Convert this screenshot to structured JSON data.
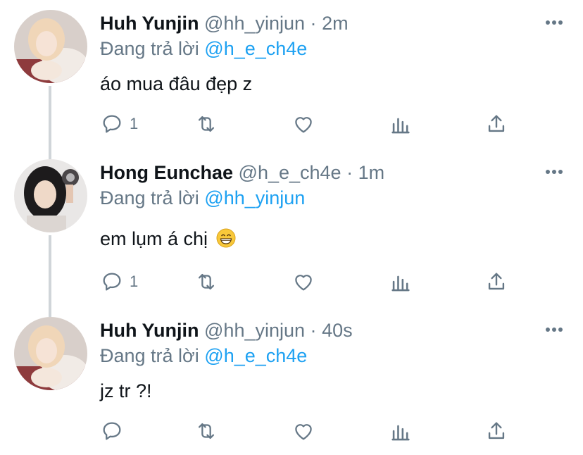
{
  "tweets": [
    {
      "name": "Huh Yunjin",
      "handle": "@hh_yinjun",
      "dot": "·",
      "time": "2m",
      "reply_prefix": "Đang trả lời",
      "reply_to": "@h_e_ch4e",
      "text": "áo mua đâu đẹp z",
      "reply_count": "1"
    },
    {
      "name": "Hong Eunchae",
      "handle": "@h_e_ch4e",
      "dot": "·",
      "time": "1m",
      "reply_prefix": "Đang trả lời",
      "reply_to": "@hh_yinjun",
      "text": "em lụm á chị",
      "reply_count": "1"
    },
    {
      "name": "Huh Yunjin",
      "handle": "@hh_yinjun",
      "dot": "·",
      "time": "40s",
      "reply_prefix": "Đang trả lời",
      "reply_to": "@h_e_ch4e",
      "text": "jz tr ?!",
      "reply_count": ""
    }
  ],
  "icons": {
    "reply": "comment-icon",
    "retweet": "retweet-icon",
    "like": "heart-icon",
    "analytics": "analytics-icon",
    "share": "share-icon",
    "more": "more-icon"
  },
  "colors": {
    "text": "#0f1419",
    "secondary": "#657786",
    "link": "#1da1f2",
    "thread_line": "#d0d5d9"
  }
}
